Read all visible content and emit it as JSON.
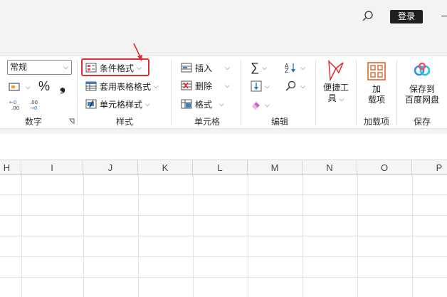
{
  "titlebar": {
    "login_label": "登录"
  },
  "number_group": {
    "format_value": "常规",
    "percent_symbol": "%",
    "comma_symbol": "❟",
    "label": "数字"
  },
  "styles_group": {
    "conditional_format": "条件格式",
    "table_format": "套用表格格式",
    "cell_style": "单元格样式",
    "label": "样式"
  },
  "cells_group": {
    "insert": "插入",
    "delete": "删除",
    "format": "格式",
    "label": "单元格"
  },
  "edit_group": {
    "label": "编辑"
  },
  "tools_group": {
    "line1": "便捷工",
    "line2": "具"
  },
  "addins_group": {
    "line1": "加",
    "line2": "载项",
    "label": "加载项"
  },
  "save_group": {
    "line1": "保存到",
    "line2": "百度网盘",
    "label": "保存"
  },
  "columns": [
    "H",
    "I",
    "J",
    "K",
    "L",
    "M",
    "N",
    "O",
    "P"
  ],
  "colors": {
    "highlight": "#e02d2d",
    "accent_green": "#217346"
  }
}
